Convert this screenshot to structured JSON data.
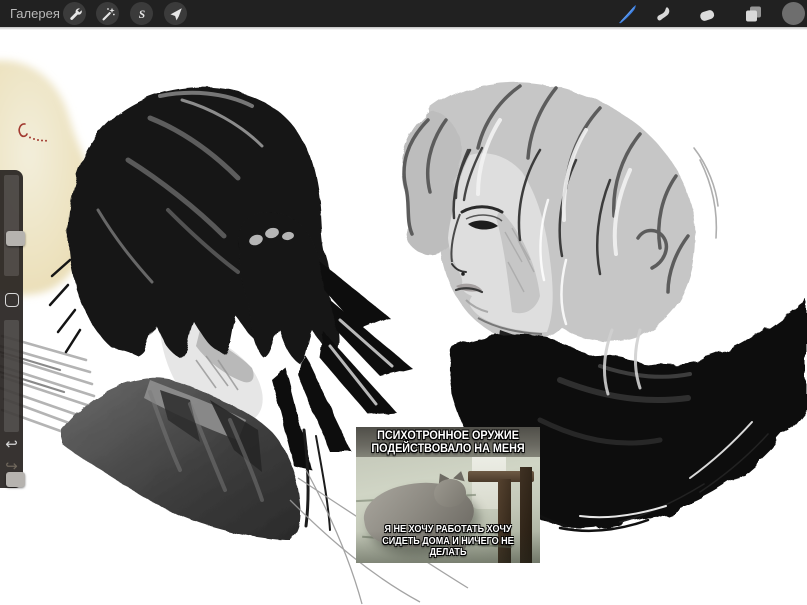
{
  "topbar": {
    "gallery_label": "Галерея",
    "left_tools": [
      {
        "id": "actions",
        "icon": "wrench-icon"
      },
      {
        "id": "adjustments",
        "icon": "magic-wand-icon"
      },
      {
        "id": "selection",
        "icon": "selection-s-icon"
      },
      {
        "id": "transform",
        "icon": "transform-arrow-icon"
      }
    ],
    "right_tools": [
      {
        "id": "paint",
        "icon": "paintbrush-stroke-icon",
        "active": true
      },
      {
        "id": "smudge",
        "icon": "smudge-finger-icon",
        "active": false
      },
      {
        "id": "erase",
        "icon": "eraser-icon",
        "active": false
      },
      {
        "id": "layers",
        "icon": "layers-icon",
        "active": false
      },
      {
        "id": "color",
        "icon": "color-swatch-circle",
        "active": false
      }
    ]
  },
  "sidebar": {
    "controls": [
      "brush-size-slider",
      "modify-button",
      "opacity-slider",
      "undo-button",
      "redo-button"
    ],
    "undo_glyph": "↩",
    "redo_glyph": "↪"
  },
  "canvas": {
    "meme": {
      "top_text_line1": "ПСИХОТРОННОЕ ОРУЖИЕ",
      "top_text_line2": "ПОДЕЙСТВОВАЛО НА МЕНЯ",
      "bottom_text_line1": "Я НЕ ХОЧУ РАБОТАТЬ ХОЧУ",
      "bottom_text_line2": "СИДЕТЬ ДОМА И НИЧЕГО НЕ ДЕЛАТЬ"
    }
  },
  "colors": {
    "topbar_bg": "#212121",
    "accent_blue": "#3b7fe3",
    "sidebar_bg": "rgba(38,34,31,0.92)",
    "canvas_bg": "#ffffff",
    "beige_blob": "#ece1bd",
    "red_mark": "#a23a30",
    "current_color_swatch": "#6e6e6e"
  }
}
